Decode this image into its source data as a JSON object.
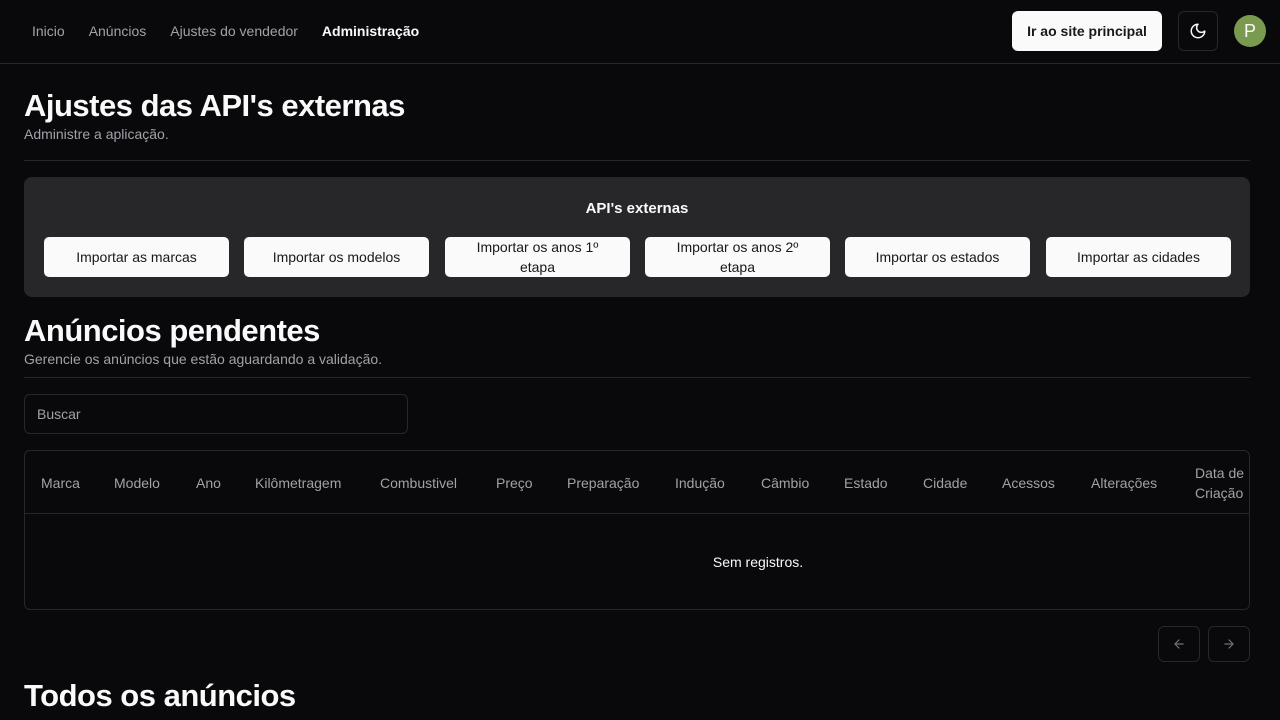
{
  "nav": {
    "links": [
      "Inicio",
      "Anúncios",
      "Ajustes do vendedor",
      "Administração"
    ],
    "main_site_button": "Ir ao site principal",
    "theme_icon": "moon-icon",
    "avatar_letter": "P",
    "avatar_color": "#7a9a4f"
  },
  "api_section": {
    "title": "Ajustes das API's externas",
    "subtitle": "Administre a aplicação.",
    "card_title": "API's externas",
    "buttons": [
      "Importar as marcas",
      "Importar os modelos",
      "Importar os anos 1º etapa",
      "Importar os anos 2º etapa",
      "Importar os estados",
      "Importar as cidades"
    ]
  },
  "pending_section": {
    "title": "Anúncios pendentes",
    "subtitle": "Gerencie os anúncios que estão aguardando a validação.",
    "search_placeholder": "Buscar",
    "columns": [
      "Marca",
      "Modelo",
      "Ano",
      "Kilômetragem",
      "Combustivel",
      "Preço",
      "Preparação",
      "Indução",
      "Câmbio",
      "Estado",
      "Cidade",
      "Acessos",
      "Alterações",
      "Data de Criação"
    ],
    "empty_text": "Sem registros.",
    "prev_icon": "arrow-left-icon",
    "next_icon": "arrow-right-icon"
  },
  "all_section": {
    "title": "Todos os anúncios"
  },
  "colors": {
    "background": "#09090b",
    "card": "#27272a",
    "border": "#27272a",
    "muted_text": "#a1a1aa",
    "primary_button": "#fafafa"
  }
}
